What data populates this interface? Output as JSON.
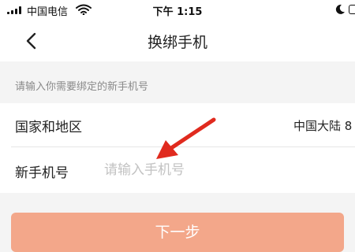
{
  "status_bar": {
    "carrier": "中国电信",
    "time": "下午 1:15"
  },
  "nav": {
    "title": "换绑手机",
    "back_icon": "chevron-left-icon"
  },
  "form": {
    "hint": "请输入你需要绑定的新手机号",
    "country_label": "国家和地区",
    "country_value": "中国大陆 8",
    "phone_label": "新手机号",
    "phone_placeholder": "请输入手机号",
    "phone_value": ""
  },
  "next_button": {
    "label": "下一步"
  },
  "colors": {
    "button": "#f3a78a",
    "arrow": "#e02a1e",
    "background": "#f4f4f4"
  }
}
